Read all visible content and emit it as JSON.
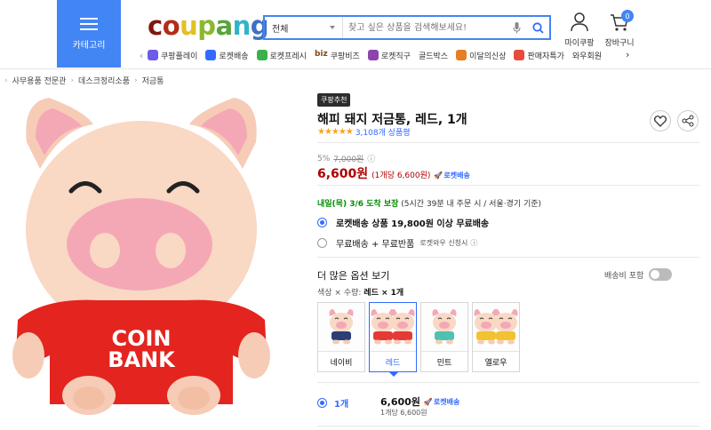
{
  "header": {
    "category_label": "카테고리",
    "logo_letters": [
      "c",
      "o",
      "u",
      "p",
      "a",
      "n",
      "g"
    ],
    "logo_colors": [
      "#82150f",
      "#b12d18",
      "#e0c125",
      "#8bb82c",
      "#5aa43e",
      "#2eb5c9",
      "#3d72c3"
    ],
    "search": {
      "category_value": "전체",
      "placeholder": "찾고 싶은 상품을 검색해보세요!"
    },
    "mypage_label": "마이쿠팡",
    "cart_label": "장바구니",
    "cart_count": "0"
  },
  "nav": {
    "items": [
      {
        "label": "쿠팡플레이",
        "icon": "play-icon",
        "color": "#6c5ce7"
      },
      {
        "label": "로켓배송",
        "icon": "rocket-icon",
        "color": "#346aff"
      },
      {
        "label": "로켓프레시",
        "icon": "rocket-fresh-icon",
        "color": "#3cb14a"
      },
      {
        "label": "쿠팡비즈",
        "icon": "biz-icon",
        "color": "#7d4b16",
        "prefix": "biz"
      },
      {
        "label": "로켓직구",
        "icon": "global-icon",
        "color": "#8e44ad"
      },
      {
        "label": "골드박스",
        "icon": "",
        "color": ""
      },
      {
        "label": "이달의신상",
        "icon": "bag-icon",
        "color": "#e67e22"
      },
      {
        "label": "판매자특가",
        "icon": "percent-icon",
        "color": "#e74c3c"
      },
      {
        "label": "와우회원",
        "icon": "",
        "color": ""
      }
    ]
  },
  "breadcrumbs": [
    "사무용품 전문관",
    "데스크정리소품",
    "저금통"
  ],
  "product": {
    "badge": "쿠팡추천",
    "title": "해피 돼지 저금통, 레드, 1개",
    "stars": "★★★★★",
    "rating": 4.5,
    "review_count": "3,108개 상품평",
    "discount_rate": "5%",
    "original_price": "7,000원",
    "price": "6,600원",
    "unit_price": "(1개당 6,600원)",
    "rocket_label": "로켓배송",
    "delivery_date": "내일(목) 3/6 도착 보장",
    "delivery_note": "(5시간 39분  내 주문 시 / 서울⋅경기 기준)",
    "shipping_options": [
      {
        "text": "로켓배송 상품 19,800원 이상 무료배송",
        "selected": true
      },
      {
        "text": "무료배송 + 무료반품",
        "sub": "로켓와우 신청시",
        "selected": false
      }
    ],
    "more_options_label": "더 많은 옵션 보기",
    "shipping_included_label": "배송비 포함",
    "option_selection_prefix": "색상 × 수량:",
    "option_selection_value": "레드 × 1개",
    "swatches": [
      {
        "name": "네이비",
        "shirt": "#2c3e75",
        "selected": false
      },
      {
        "name": "레드",
        "shirt": "#e53935",
        "selected": true
      },
      {
        "name": "민트",
        "shirt": "#4fc1b1",
        "selected": false
      },
      {
        "name": "옐로우",
        "shirt": "#f2c230",
        "selected": false
      }
    ],
    "quantity_option": "1개",
    "selected_price": "6,600원",
    "selected_unit": "1개당 6,600원",
    "pig_text_line1": "COIN",
    "pig_text_line2": "BANK"
  },
  "colors": {
    "accent": "#346aff",
    "category_blue": "#4285f4",
    "price_red": "#ae0000",
    "pig_skin": "#f9d8c4",
    "pig_snout": "#f4a8b6",
    "pig_shirt": "#e4241f"
  }
}
